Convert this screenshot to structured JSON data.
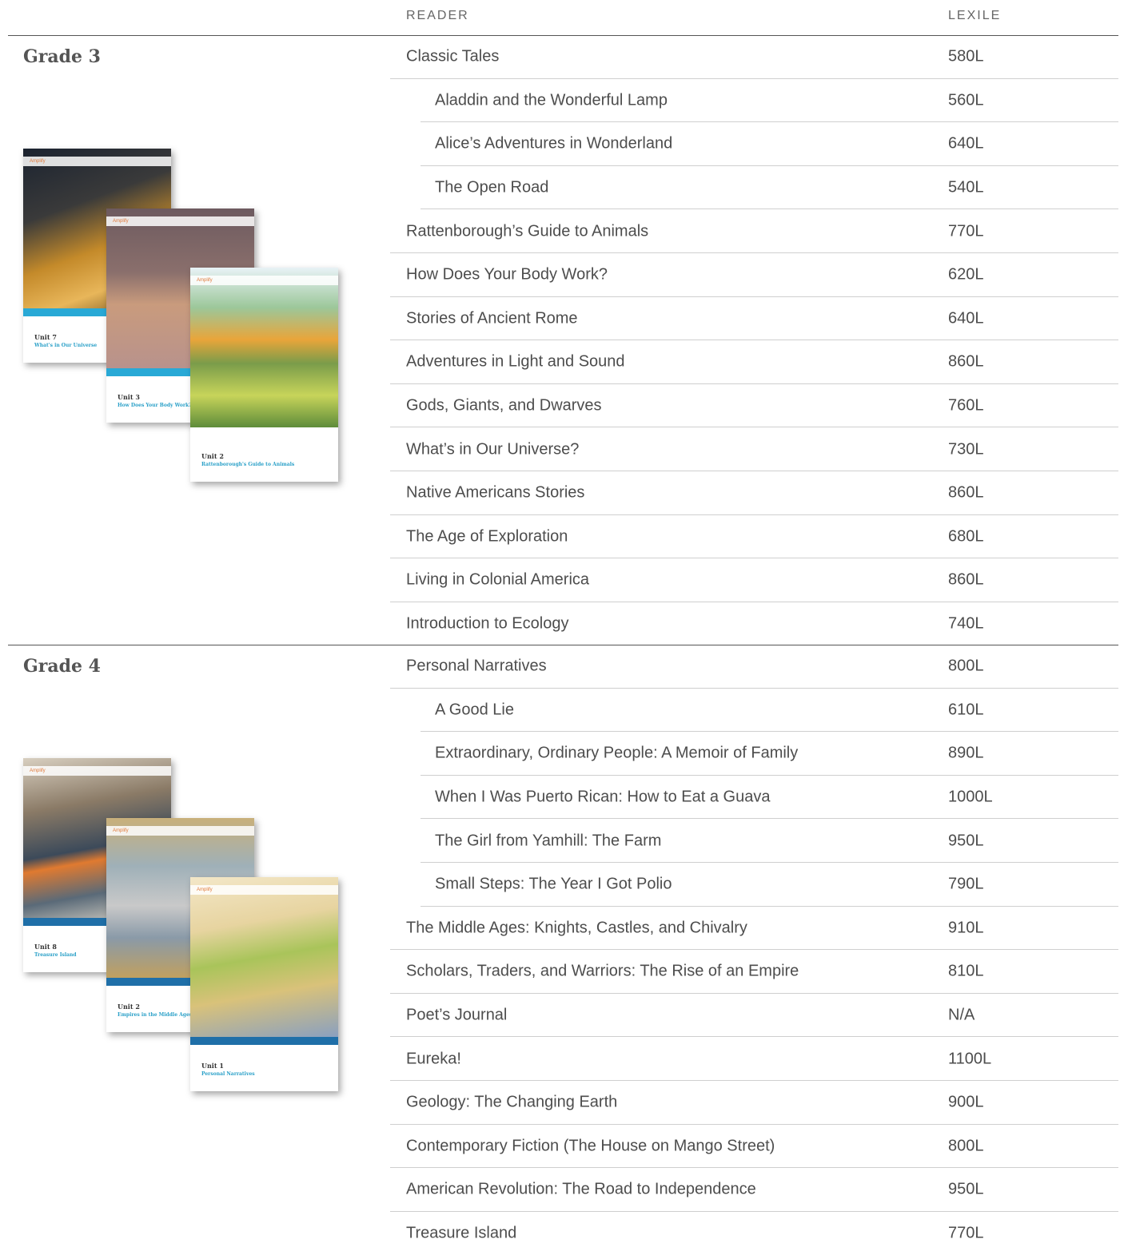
{
  "header": {
    "reader": "READER",
    "lexile": "LEXILE"
  },
  "grades": [
    {
      "title": "Grade 3",
      "covers": [
        {
          "unit": "Unit 7",
          "title": "What's in Our Universe",
          "top_label": "Amplify"
        },
        {
          "unit": "Unit 3",
          "title": "How Does Your Body Work?",
          "top_label": "Amplify"
        },
        {
          "unit": "Unit 2",
          "title": "Rattenborough's Guide to Animals",
          "top_label": "Amplify"
        }
      ],
      "rows": [
        {
          "title": "Classic Tales",
          "lexile": "580L",
          "indent": false
        },
        {
          "title": "Aladdin and the Wonderful Lamp",
          "lexile": "560L",
          "indent": true
        },
        {
          "title": "Alice’s Adventures in Wonderland",
          "lexile": "640L",
          "indent": true
        },
        {
          "title": "The Open Road",
          "lexile": "540L",
          "indent": true
        },
        {
          "title": "Rattenborough’s Guide to Animals",
          "lexile": "770L",
          "indent": false
        },
        {
          "title": "How Does Your Body Work?",
          "lexile": "620L",
          "indent": false
        },
        {
          "title": "Stories of Ancient Rome",
          "lexile": "640L",
          "indent": false
        },
        {
          "title": "Adventures in Light and Sound",
          "lexile": "860L",
          "indent": false
        },
        {
          "title": "Gods, Giants, and Dwarves",
          "lexile": "760L",
          "indent": false
        },
        {
          "title": "What’s in Our Universe?",
          "lexile": "730L",
          "indent": false
        },
        {
          "title": "Native Americans Stories",
          "lexile": "860L",
          "indent": false
        },
        {
          "title": "The Age of Exploration",
          "lexile": "680L",
          "indent": false
        },
        {
          "title": "Living in Colonial America",
          "lexile": "860L",
          "indent": false
        },
        {
          "title": "Introduction to Ecology",
          "lexile": "740L",
          "indent": false
        }
      ]
    },
    {
      "title": "Grade 4",
      "covers": [
        {
          "unit": "Unit 8",
          "title": "Treasure Island",
          "top_label": "Amplify"
        },
        {
          "unit": "Unit 2",
          "title": "Empires in the Middle Ages",
          "top_label": "Amplify"
        },
        {
          "unit": "Unit 1",
          "title": "Personal Narratives",
          "top_label": "Amplify"
        }
      ],
      "rows": [
        {
          "title": "Personal Narratives",
          "lexile": "800L",
          "indent": false
        },
        {
          "title": "A Good Lie",
          "lexile": "610L",
          "indent": true
        },
        {
          "title": "Extraordinary, Ordinary People: A Memoir of Family",
          "lexile": "890L",
          "indent": true
        },
        {
          "title": "When I Was Puerto Rican: How to Eat a Guava",
          "lexile": "1000L",
          "indent": true
        },
        {
          "title": "The Girl from Yamhill: The Farm",
          "lexile": "950L",
          "indent": true
        },
        {
          "title": "Small Steps: The Year I Got Polio",
          "lexile": "790L",
          "indent": true
        },
        {
          "title": "The Middle Ages: Knights, Castles, and Chivalry",
          "lexile": "910L",
          "indent": false
        },
        {
          "title": "Scholars, Traders, and Warriors: The Rise of an Empire",
          "lexile": "810L",
          "indent": false
        },
        {
          "title": "Poet’s Journal",
          "lexile": "N/A",
          "indent": false
        },
        {
          "title": "Eureka!",
          "lexile": "1100L",
          "indent": false
        },
        {
          "title": "Geology: The Changing Earth",
          "lexile": "900L",
          "indent": false
        },
        {
          "title": "Contemporary Fiction (The House on Mango Street)",
          "lexile": "800L",
          "indent": false
        },
        {
          "title": "American Revolution: The Road to Independence",
          "lexile": "950L",
          "indent": false
        },
        {
          "title": "Treasure Island",
          "lexile": "770L",
          "indent": false
        }
      ]
    }
  ]
}
